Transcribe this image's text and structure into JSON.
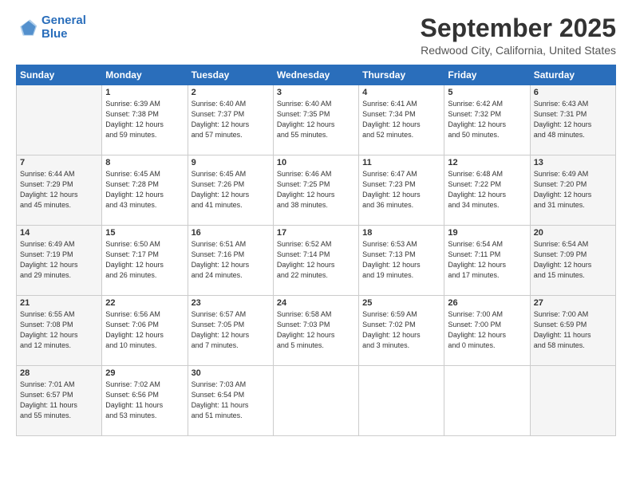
{
  "logo": {
    "line1": "General",
    "line2": "Blue"
  },
  "title": "September 2025",
  "location": "Redwood City, California, United States",
  "days_header": [
    "Sunday",
    "Monday",
    "Tuesday",
    "Wednesday",
    "Thursday",
    "Friday",
    "Saturday"
  ],
  "weeks": [
    [
      {
        "num": "",
        "info": ""
      },
      {
        "num": "1",
        "info": "Sunrise: 6:39 AM\nSunset: 7:38 PM\nDaylight: 12 hours\nand 59 minutes."
      },
      {
        "num": "2",
        "info": "Sunrise: 6:40 AM\nSunset: 7:37 PM\nDaylight: 12 hours\nand 57 minutes."
      },
      {
        "num": "3",
        "info": "Sunrise: 6:40 AM\nSunset: 7:35 PM\nDaylight: 12 hours\nand 55 minutes."
      },
      {
        "num": "4",
        "info": "Sunrise: 6:41 AM\nSunset: 7:34 PM\nDaylight: 12 hours\nand 52 minutes."
      },
      {
        "num": "5",
        "info": "Sunrise: 6:42 AM\nSunset: 7:32 PM\nDaylight: 12 hours\nand 50 minutes."
      },
      {
        "num": "6",
        "info": "Sunrise: 6:43 AM\nSunset: 7:31 PM\nDaylight: 12 hours\nand 48 minutes."
      }
    ],
    [
      {
        "num": "7",
        "info": "Sunrise: 6:44 AM\nSunset: 7:29 PM\nDaylight: 12 hours\nand 45 minutes."
      },
      {
        "num": "8",
        "info": "Sunrise: 6:45 AM\nSunset: 7:28 PM\nDaylight: 12 hours\nand 43 minutes."
      },
      {
        "num": "9",
        "info": "Sunrise: 6:45 AM\nSunset: 7:26 PM\nDaylight: 12 hours\nand 41 minutes."
      },
      {
        "num": "10",
        "info": "Sunrise: 6:46 AM\nSunset: 7:25 PM\nDaylight: 12 hours\nand 38 minutes."
      },
      {
        "num": "11",
        "info": "Sunrise: 6:47 AM\nSunset: 7:23 PM\nDaylight: 12 hours\nand 36 minutes."
      },
      {
        "num": "12",
        "info": "Sunrise: 6:48 AM\nSunset: 7:22 PM\nDaylight: 12 hours\nand 34 minutes."
      },
      {
        "num": "13",
        "info": "Sunrise: 6:49 AM\nSunset: 7:20 PM\nDaylight: 12 hours\nand 31 minutes."
      }
    ],
    [
      {
        "num": "14",
        "info": "Sunrise: 6:49 AM\nSunset: 7:19 PM\nDaylight: 12 hours\nand 29 minutes."
      },
      {
        "num": "15",
        "info": "Sunrise: 6:50 AM\nSunset: 7:17 PM\nDaylight: 12 hours\nand 26 minutes."
      },
      {
        "num": "16",
        "info": "Sunrise: 6:51 AM\nSunset: 7:16 PM\nDaylight: 12 hours\nand 24 minutes."
      },
      {
        "num": "17",
        "info": "Sunrise: 6:52 AM\nSunset: 7:14 PM\nDaylight: 12 hours\nand 22 minutes."
      },
      {
        "num": "18",
        "info": "Sunrise: 6:53 AM\nSunset: 7:13 PM\nDaylight: 12 hours\nand 19 minutes."
      },
      {
        "num": "19",
        "info": "Sunrise: 6:54 AM\nSunset: 7:11 PM\nDaylight: 12 hours\nand 17 minutes."
      },
      {
        "num": "20",
        "info": "Sunrise: 6:54 AM\nSunset: 7:09 PM\nDaylight: 12 hours\nand 15 minutes."
      }
    ],
    [
      {
        "num": "21",
        "info": "Sunrise: 6:55 AM\nSunset: 7:08 PM\nDaylight: 12 hours\nand 12 minutes."
      },
      {
        "num": "22",
        "info": "Sunrise: 6:56 AM\nSunset: 7:06 PM\nDaylight: 12 hours\nand 10 minutes."
      },
      {
        "num": "23",
        "info": "Sunrise: 6:57 AM\nSunset: 7:05 PM\nDaylight: 12 hours\nand 7 minutes."
      },
      {
        "num": "24",
        "info": "Sunrise: 6:58 AM\nSunset: 7:03 PM\nDaylight: 12 hours\nand 5 minutes."
      },
      {
        "num": "25",
        "info": "Sunrise: 6:59 AM\nSunset: 7:02 PM\nDaylight: 12 hours\nand 3 minutes."
      },
      {
        "num": "26",
        "info": "Sunrise: 7:00 AM\nSunset: 7:00 PM\nDaylight: 12 hours\nand 0 minutes."
      },
      {
        "num": "27",
        "info": "Sunrise: 7:00 AM\nSunset: 6:59 PM\nDaylight: 11 hours\nand 58 minutes."
      }
    ],
    [
      {
        "num": "28",
        "info": "Sunrise: 7:01 AM\nSunset: 6:57 PM\nDaylight: 11 hours\nand 55 minutes."
      },
      {
        "num": "29",
        "info": "Sunrise: 7:02 AM\nSunset: 6:56 PM\nDaylight: 11 hours\nand 53 minutes."
      },
      {
        "num": "30",
        "info": "Sunrise: 7:03 AM\nSunset: 6:54 PM\nDaylight: 11 hours\nand 51 minutes."
      },
      {
        "num": "",
        "info": ""
      },
      {
        "num": "",
        "info": ""
      },
      {
        "num": "",
        "info": ""
      },
      {
        "num": "",
        "info": ""
      }
    ]
  ]
}
